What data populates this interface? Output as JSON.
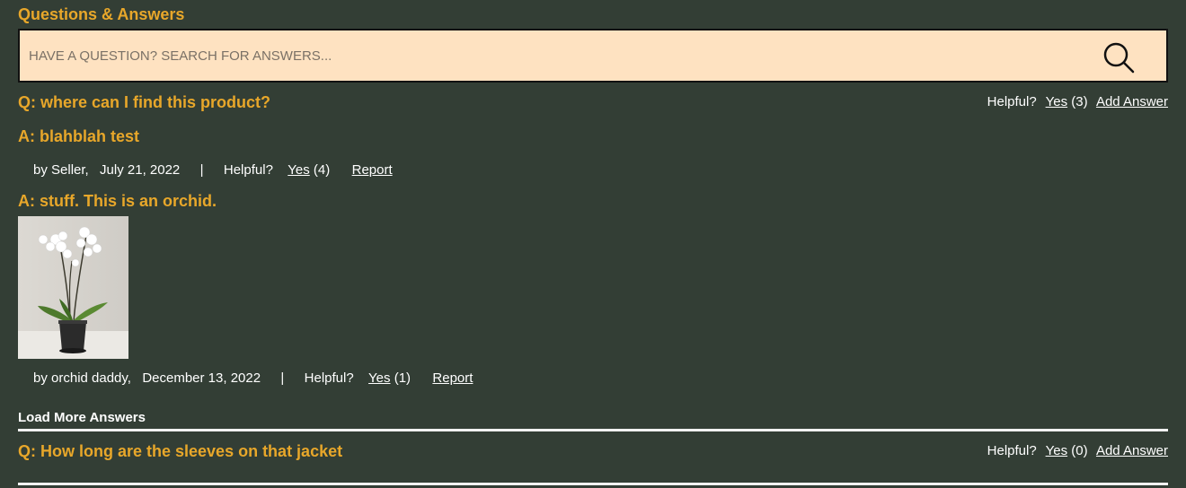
{
  "section": {
    "title": "Questions & Answers"
  },
  "search": {
    "placeholder": "HAVE A QUESTION? SEARCH FOR ANSWERS...",
    "icon": "magnifier"
  },
  "questions": [
    {
      "text": "Q: where can I find this product?",
      "helpful_label": "Helpful?",
      "yes_label": "Yes",
      "yes_count": "(3)",
      "add_answer_label": "Add Answer",
      "answers": [
        {
          "text": "A: blahblah test",
          "byline": "by Seller,",
          "date": "July 21, 2022",
          "separator": "|",
          "helpful_label": "Helpful?",
          "yes_label": "Yes",
          "yes_count": "(4)",
          "report_label": "Report"
        },
        {
          "text": "A: stuff. This is an orchid.",
          "photo": "white orchid in black pot",
          "byline": "by orchid daddy,",
          "date": "December 13, 2022",
          "separator": "|",
          "helpful_label": "Helpful?",
          "yes_label": "Yes",
          "yes_count": "(1)",
          "report_label": "Report"
        }
      ],
      "load_more_label": "Load More Answers"
    },
    {
      "text": "Q: How long are the sleeves on that jacket",
      "helpful_label": "Helpful?",
      "yes_label": "Yes",
      "yes_count": "(0)",
      "add_answer_label": "Add Answer"
    }
  ],
  "colors": {
    "background": "#333e35",
    "accent": "#e8a72a",
    "search_bg": "#fee2c1",
    "text": "#ffffff"
  }
}
